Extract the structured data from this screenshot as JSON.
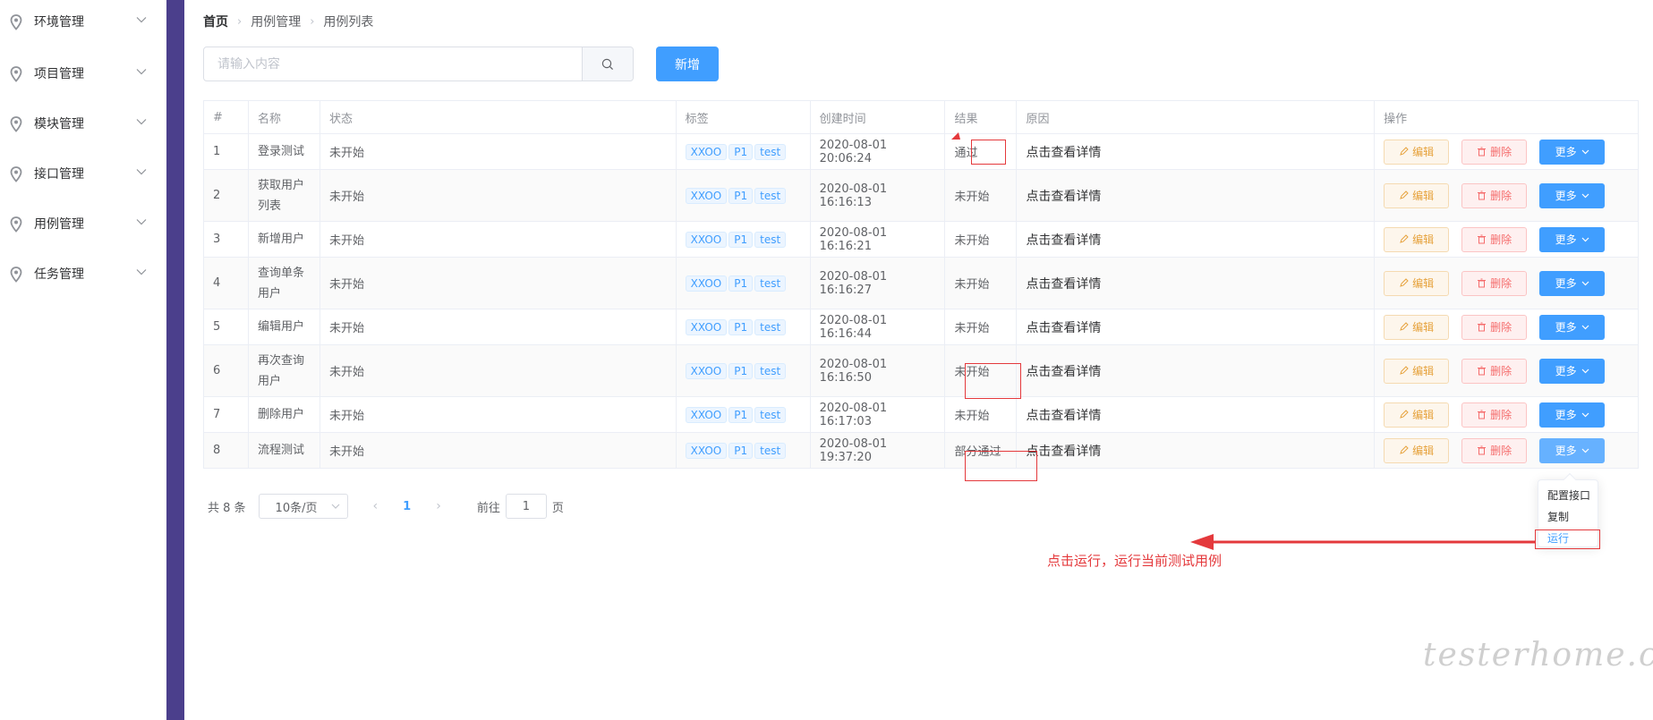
{
  "sidebar": {
    "items": [
      {
        "label": "环境管理"
      },
      {
        "label": "项目管理"
      },
      {
        "label": "模块管理"
      },
      {
        "label": "接口管理"
      },
      {
        "label": "用例管理"
      },
      {
        "label": "任务管理"
      }
    ]
  },
  "breadcrumb": {
    "home": "首页",
    "level1": "用例管理",
    "level2": "用例列表"
  },
  "search": {
    "placeholder": "请输入内容",
    "value": ""
  },
  "add_label": "新增",
  "table": {
    "headers": {
      "idx": "#",
      "name": "名称",
      "status": "状态",
      "tags": "标签",
      "time": "创建时间",
      "result": "结果",
      "reason": "原因",
      "op": "操作"
    },
    "rows": [
      {
        "idx": "1",
        "name": "登录测试",
        "status": "未开始",
        "tag1": "XXOO",
        "tag2": "P1",
        "tag3": "test",
        "time": "2020-08-01 20:06:24",
        "result": "通过",
        "reason": "点击查看详情"
      },
      {
        "idx": "2",
        "name": "获取用户列表",
        "status": "未开始",
        "tag1": "XXOO",
        "tag2": "P1",
        "tag3": "test",
        "time": "2020-08-01 16:16:13",
        "result": "未开始",
        "reason": "点击查看详情"
      },
      {
        "idx": "3",
        "name": "新增用户",
        "status": "未开始",
        "tag1": "XXOO",
        "tag2": "P1",
        "tag3": "test",
        "time": "2020-08-01 16:16:21",
        "result": "未开始",
        "reason": "点击查看详情"
      },
      {
        "idx": "4",
        "name": "查询单条用户",
        "status": "未开始",
        "tag1": "XXOO",
        "tag2": "P1",
        "tag3": "test",
        "time": "2020-08-01 16:16:27",
        "result": "未开始",
        "reason": "点击查看详情"
      },
      {
        "idx": "5",
        "name": "编辑用户",
        "status": "未开始",
        "tag1": "XXOO",
        "tag2": "P1",
        "tag3": "test",
        "time": "2020-08-01 16:16:44",
        "result": "未开始",
        "reason": "点击查看详情"
      },
      {
        "idx": "6",
        "name": "再次查询用户",
        "status": "未开始",
        "tag1": "XXOO",
        "tag2": "P1",
        "tag3": "test",
        "time": "2020-08-01 16:16:50",
        "result": "未开始",
        "reason": "点击查看详情"
      },
      {
        "idx": "7",
        "name": "删除用户",
        "status": "未开始",
        "tag1": "XXOO",
        "tag2": "P1",
        "tag3": "test",
        "time": "2020-08-01 16:17:03",
        "result": "未开始",
        "reason": "点击查看详情"
      },
      {
        "idx": "8",
        "name": "流程测试",
        "status": "未开始",
        "tag1": "XXOO",
        "tag2": "P1",
        "tag3": "test",
        "time": "2020-08-01 19:37:20",
        "result": "部分通过",
        "reason": "点击查看详情"
      }
    ],
    "edit_label": "编辑",
    "delete_label": "删除",
    "more_label": "更多"
  },
  "pagination": {
    "total": "共 8 条",
    "page_size": "10条/页",
    "current": "1",
    "goto_prefix": "前往",
    "goto_value": "1",
    "goto_suffix": "页"
  },
  "dropdown": {
    "items": [
      "配置接口",
      "复制",
      "运行"
    ]
  },
  "annotation": "点击运行，运行当前测试用例",
  "watermark": "testerhome.com",
  "colors": {
    "primary": "#409eff",
    "sidebar_strip": "#4b3f8c",
    "annotation": "#e4393c"
  }
}
